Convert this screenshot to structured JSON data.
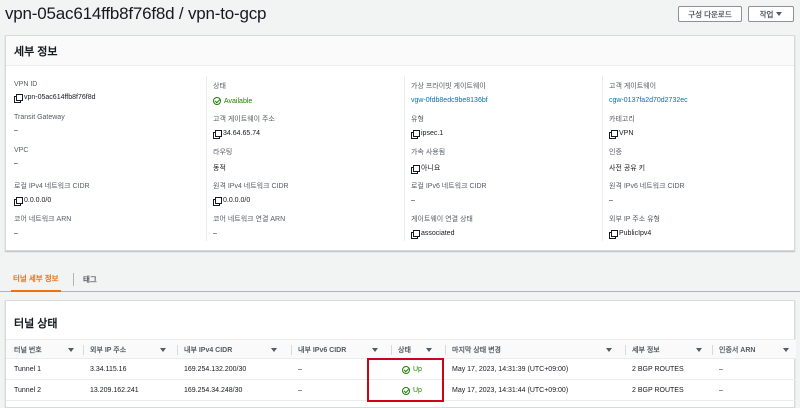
{
  "page": {
    "title": "vpn-05ac614ffb8f76f8d / vpn-to-gcp"
  },
  "header_buttons": {
    "download": "구성 다운로드",
    "actions": "작업"
  },
  "details": {
    "heading": "세부 정보",
    "columns": [
      [
        {
          "label": "VPN ID",
          "value": "vpn-05ac614ffb8f76f8d",
          "copy": true,
          "style": "plain"
        },
        {
          "label": "Transit Gateway",
          "value": "–",
          "copy": false,
          "style": "plain"
        },
        {
          "label": "VPC",
          "value": "–",
          "copy": false,
          "style": "plain"
        },
        {
          "label": "로컬 IPv4 네트워크 CIDR",
          "value": "0.0.0.0/0",
          "copy": true,
          "style": "plain"
        },
        {
          "label": "코어 네트워크 ARN",
          "value": "–",
          "copy": false,
          "style": "plain"
        }
      ],
      [
        {
          "label": "상태",
          "value": "Available",
          "copy": false,
          "style": "ok"
        },
        {
          "label": "고객 게이트웨이 주소",
          "value": "34.64.65.74",
          "copy": true,
          "style": "plain"
        },
        {
          "label": "라우팅",
          "value": "동적",
          "copy": false,
          "style": "plain"
        },
        {
          "label": "원격 IPv4 네트워크 CIDR",
          "value": "0.0.0.0/0",
          "copy": true,
          "style": "plain"
        },
        {
          "label": "코어 네트워크 연결 ARN",
          "value": "–",
          "copy": false,
          "style": "plain"
        }
      ],
      [
        {
          "label": "가상 프라이빗 게이트웨이",
          "value": "vgw-0fdb8edc9be8136bf",
          "copy": false,
          "style": "link"
        },
        {
          "label": "유형",
          "value": "ipsec.1",
          "copy": true,
          "style": "plain"
        },
        {
          "label": "가속 사용됨",
          "value": "아니요",
          "copy": true,
          "style": "plain"
        },
        {
          "label": "로컬 IPv6 네트워크 CIDR",
          "value": "–",
          "copy": false,
          "style": "plain"
        },
        {
          "label": "게이트웨이 연결 상태",
          "value": "associated",
          "copy": true,
          "style": "plain"
        }
      ],
      [
        {
          "label": "고객 게이트웨이",
          "value": "cgw-0137fa2d70d2732ec",
          "copy": false,
          "style": "link"
        },
        {
          "label": "카테고리",
          "value": "VPN",
          "copy": true,
          "style": "plain"
        },
        {
          "label": "인증",
          "value": "사전 공유 키",
          "copy": false,
          "style": "plain"
        },
        {
          "label": "원격 IPv6 네트워크 CIDR",
          "value": "–",
          "copy": false,
          "style": "plain"
        },
        {
          "label": "외부 IP 주소 유형",
          "value": "PublicIpv4",
          "copy": true,
          "style": "plain"
        }
      ]
    ]
  },
  "tabs": [
    {
      "label": "터널 세부 정보",
      "active": true
    },
    {
      "label": "태그",
      "active": false
    }
  ],
  "tunnel": {
    "heading": "터널 상태",
    "columns": [
      "터널 번호",
      "외부 IP 주소",
      "내부 IPv4 CIDR",
      "내부 IPv6 CIDR",
      "상태",
      "마지막 상태 변경",
      "세부 정보",
      "인증서 ARN"
    ],
    "rows": [
      {
        "number": "Tunnel 1",
        "outside_ip": "3.34.115.16",
        "inside_ipv4": "169.254.132.200/30",
        "inside_ipv6": "–",
        "status": "Up",
        "last_change": "May 17, 2023, 14:31:39 (UTC+09:00)",
        "details": "2 BGP ROUTES",
        "cert_arn": "–"
      },
      {
        "number": "Tunnel 2",
        "outside_ip": "13.209.162.241",
        "inside_ipv4": "169.254.34.248/30",
        "inside_ipv6": "–",
        "status": "Up",
        "last_change": "May 17, 2023, 14:31:44 (UTC+09:00)",
        "details": "2 BGP ROUTES",
        "cert_arn": "–"
      }
    ]
  },
  "colors": {
    "link": "#0073bb",
    "ok": "#1d8102",
    "tab_active": "#ec7211",
    "highlight": "#d0021b"
  }
}
